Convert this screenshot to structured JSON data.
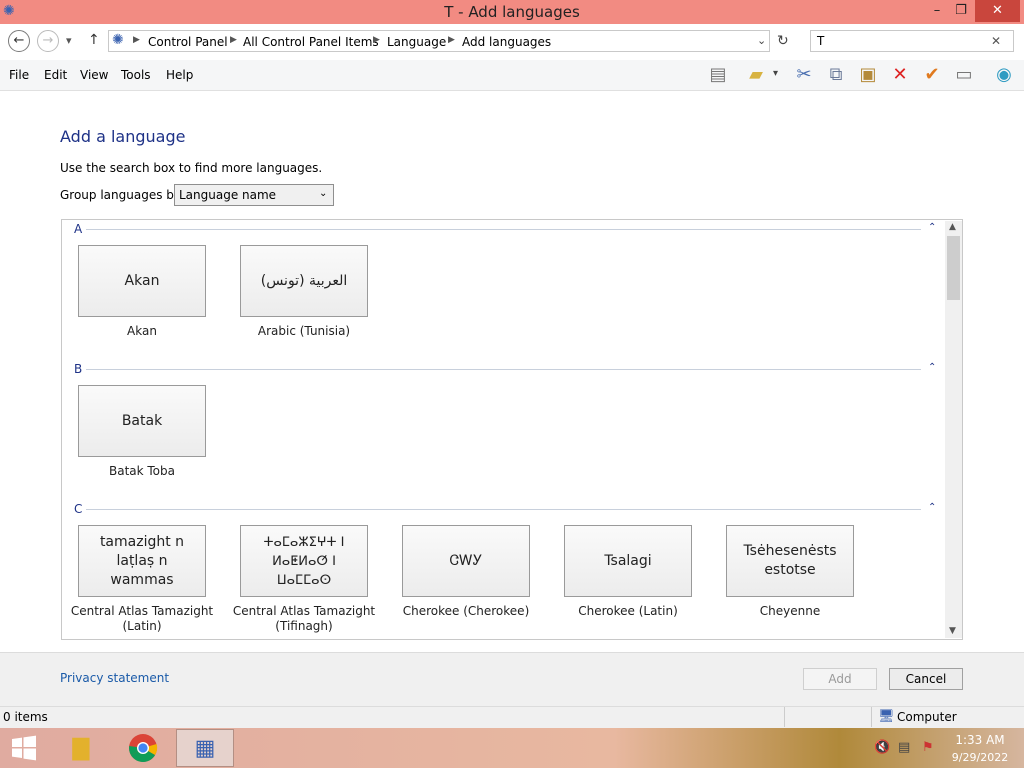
{
  "window": {
    "title": "T - Add languages",
    "minimize": "–",
    "maximize": "❐",
    "close": "✕"
  },
  "nav": {
    "back": "←",
    "forward": "→",
    "dropdown": "▾",
    "up": "↑"
  },
  "breadcrumb": [
    "Control Panel",
    "All Control Panel Items",
    "Language",
    "Add languages"
  ],
  "search": {
    "value": "T",
    "clear": "✕"
  },
  "menu": [
    "File",
    "Edit",
    "View",
    "Tools",
    "Help"
  ],
  "toolbar_icons": [
    "layout-icon",
    "properties-folder-icon",
    "cut-icon",
    "copy-icon",
    "paste-icon",
    "delete-icon",
    "checkmark-icon",
    "rename-icon",
    "shell-icon"
  ],
  "content": {
    "heading": "Add a language",
    "hint": "Use the search box to find more languages.",
    "group_label": "Group languages by:",
    "group_value": "Language name"
  },
  "groups": [
    {
      "letter": "A",
      "languages": [
        {
          "tile": "Akan",
          "caption": "Akan"
        },
        {
          "tile": "العربية (تونس)",
          "caption": "Arabic (Tunisia)"
        }
      ]
    },
    {
      "letter": "B",
      "languages": [
        {
          "tile": "Batak",
          "caption": "Batak Toba"
        }
      ]
    },
    {
      "letter": "C",
      "languages": [
        {
          "tile": "tamazight n laṭlaṣ n wammas",
          "caption": "Central Atlas Tamazight (Latin)"
        },
        {
          "tile": "ⵜⴰⵎⴰⵣⵉⵖⵜ ⵏ ⵍⴰⵟⵍⴰⵚ ⵏ ⵡⴰⵎⵎⴰⵙ",
          "caption": "Central Atlas Tamazight (Tifinagh)"
        },
        {
          "tile": "ᏣᎳᎩ",
          "caption": "Cherokee (Cherokee)"
        },
        {
          "tile": "Tsalagi",
          "caption": "Cherokee (Latin)"
        },
        {
          "tile": "Tsėhesenėstsestotse",
          "caption": "Cheyenne"
        }
      ]
    }
  ],
  "footer": {
    "privacy": "Privacy statement",
    "add": "Add",
    "cancel": "Cancel"
  },
  "status": {
    "items": "0 items",
    "location": "Computer"
  },
  "taskbar": {
    "time": "1:33 AM",
    "date": "9/29/2022"
  },
  "colors": {
    "titlebar": "#f28b82",
    "heading": "#1e3287",
    "link": "#1a5aa8"
  }
}
